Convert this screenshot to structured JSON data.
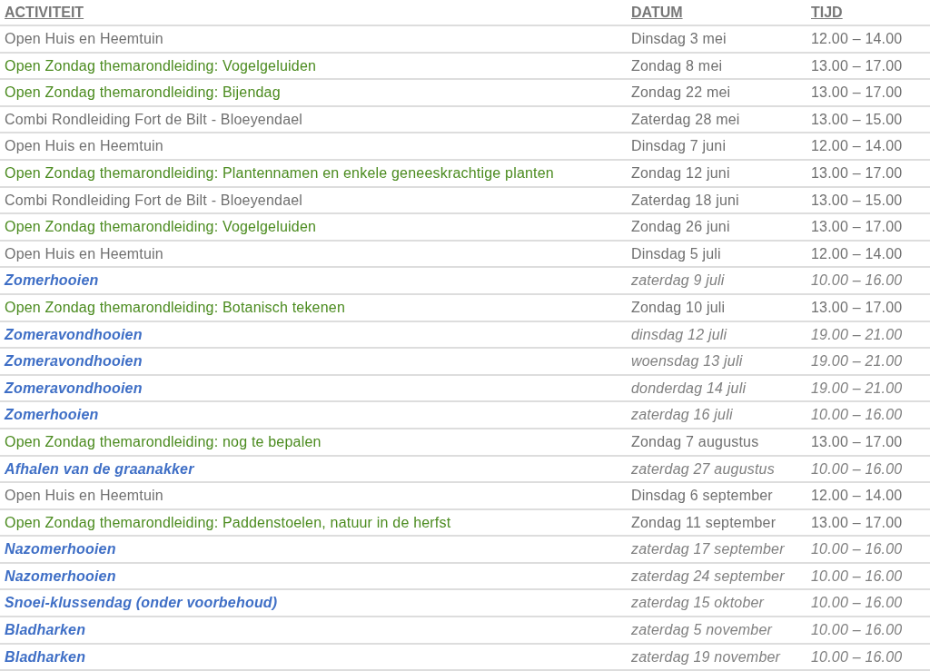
{
  "table": {
    "columns": [
      "ACTIVITEIT",
      "DATUM",
      "TIJD"
    ],
    "rows": [
      {
        "kind": "open",
        "activity": "Open Huis en Heemtuin",
        "date": "Dinsdag 3 mei",
        "time": "12.00 – 14.00"
      },
      {
        "kind": "theme",
        "activity": "Open Zondag themarondleiding: Vogelgeluiden",
        "date": "Zondag 8 mei",
        "time": "13.00 – 17.00"
      },
      {
        "kind": "theme",
        "activity": "Open Zondag themarondleiding: Bijendag",
        "date": "Zondag 22 mei",
        "time": "13.00 – 17.00"
      },
      {
        "kind": "open",
        "activity": "Combi Rondleiding Fort de Bilt - Bloeyendael",
        "date": "Zaterdag 28 mei",
        "time": "13.00 – 15.00"
      },
      {
        "kind": "open",
        "activity": "Open Huis en Heemtuin",
        "date": "Dinsdag 7 juni",
        "time": "12.00 – 14.00"
      },
      {
        "kind": "theme",
        "activity": "Open Zondag themarondleiding: Plantennamen en enkele geneeskrachtige planten",
        "date": "Zondag 12 juni",
        "time": "13.00 – 17.00"
      },
      {
        "kind": "open",
        "activity": "Combi Rondleiding Fort de Bilt - Bloeyendael",
        "date": "Zaterdag 18 juni",
        "time": "13.00 – 15.00"
      },
      {
        "kind": "theme",
        "activity": "Open Zondag themarondleiding: Vogelgeluiden",
        "date": "Zondag 26 juni",
        "time": "13.00 – 17.00"
      },
      {
        "kind": "open",
        "activity": "Open Huis en Heemtuin",
        "date": "Dinsdag 5 juli",
        "time": "12.00 – 14.00"
      },
      {
        "kind": "work",
        "activity": "Zomerhooien",
        "date": "zaterdag 9 juli",
        "time": "10.00 – 16.00"
      },
      {
        "kind": "theme",
        "activity": "Open Zondag themarondleiding: Botanisch tekenen",
        "date": "Zondag 10 juli",
        "time": "13.00 – 17.00"
      },
      {
        "kind": "work",
        "activity": "Zomeravondhooien",
        "date": "dinsdag 12 juli",
        "time": "19.00 – 21.00"
      },
      {
        "kind": "work",
        "activity": "Zomeravondhooien",
        "date": "woensdag 13 juli",
        "time": "19.00 – 21.00"
      },
      {
        "kind": "work",
        "activity": "Zomeravondhooien",
        "date": "donderdag 14 juli",
        "time": "19.00 – 21.00"
      },
      {
        "kind": "work",
        "activity": "Zomerhooien",
        "date": "zaterdag 16 juli",
        "time": "10.00 – 16.00"
      },
      {
        "kind": "theme",
        "activity": "Open Zondag themarondleiding: nog te bepalen",
        "date": "Zondag 7 augustus",
        "time": "13.00 – 17.00"
      },
      {
        "kind": "work",
        "activity": "Afhalen van de graanakker",
        "date": "zaterdag 27 augustus",
        "time": "10.00 – 16.00"
      },
      {
        "kind": "open",
        "activity": "Open Huis en Heemtuin",
        "date": "Dinsdag 6 september",
        "time": "12.00 – 14.00"
      },
      {
        "kind": "theme",
        "activity": "Open Zondag themarondleiding: Paddenstoelen, natuur in de herfst",
        "date": "Zondag 11 september",
        "time": "13.00 – 17.00"
      },
      {
        "kind": "work",
        "activity": "Nazomerhooien",
        "date": "zaterdag 17 september",
        "time": "10.00 – 16.00"
      },
      {
        "kind": "work",
        "activity": "Nazomerhooien",
        "date": "zaterdag 24 september",
        "time": "10.00 – 16.00"
      },
      {
        "kind": "work",
        "activity": "Snoei-klussendag (onder voorbehoud)",
        "date": "zaterdag 15 oktober",
        "time": "10.00 – 16.00"
      },
      {
        "kind": "work",
        "activity": "Bladharken",
        "date": "zaterdag 5 november",
        "time": "10.00 – 16.00"
      },
      {
        "kind": "work",
        "activity": "Bladharken",
        "date": "zaterdag 19 november",
        "time": "10.00 – 16.00"
      }
    ]
  }
}
